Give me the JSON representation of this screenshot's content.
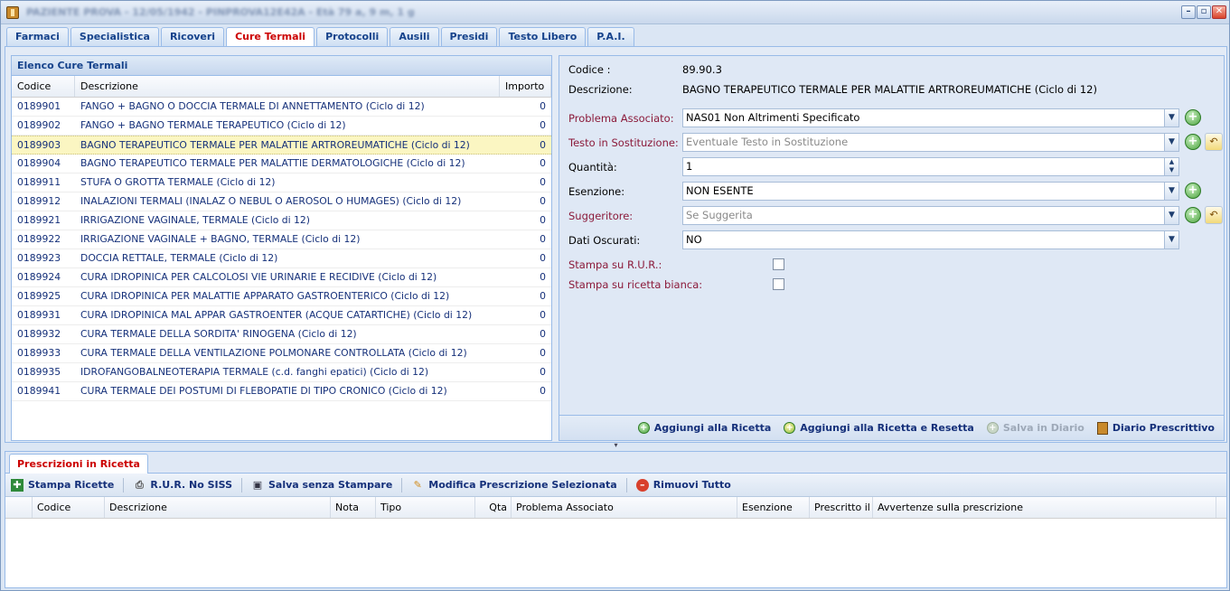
{
  "window": {
    "title": "PAZIENTE PROVA - 12/05/1942 - PINPROVA12E42A - Età 79 a, 9 m, 1 g"
  },
  "tabs": [
    "Farmaci",
    "Specialistica",
    "Ricoveri",
    "Cure Termali",
    "Protocolli",
    "Ausili",
    "Presidi",
    "Testo Libero",
    "P.A.I."
  ],
  "active_tab": "Cure Termali",
  "list": {
    "title": "Elenco Cure Termali",
    "columns": {
      "codice": "Codice",
      "descrizione": "Descrizione",
      "importo": "Importo"
    },
    "rows": [
      {
        "codice": "0189901",
        "descrizione": "FANGO + BAGNO O DOCCIA TERMALE DI ANNETTAMENTO (Ciclo di 12)",
        "importo": "0"
      },
      {
        "codice": "0189902",
        "descrizione": "FANGO + BAGNO TERMALE TERAPEUTICO (Ciclo di 12)",
        "importo": "0"
      },
      {
        "codice": "0189903",
        "descrizione": "BAGNO TERAPEUTICO TERMALE PER MALATTIE ARTROREUMATICHE (Ciclo di 12)",
        "importo": "0"
      },
      {
        "codice": "0189904",
        "descrizione": "BAGNO TERAPEUTICO TERMALE PER MALATTIE DERMATOLOGICHE (Ciclo di 12)",
        "importo": "0"
      },
      {
        "codice": "0189911",
        "descrizione": "STUFA O GROTTA TERMALE (Ciclo di 12)",
        "importo": "0"
      },
      {
        "codice": "0189912",
        "descrizione": "INALAZIONI TERMALI (INALAZ O NEBUL O AEROSOL O HUMAGES) (Ciclo di 12)",
        "importo": "0"
      },
      {
        "codice": "0189921",
        "descrizione": "IRRIGAZIONE VAGINALE, TERMALE (Ciclo di 12)",
        "importo": "0"
      },
      {
        "codice": "0189922",
        "descrizione": "IRRIGAZIONE VAGINALE + BAGNO, TERMALE (Ciclo di 12)",
        "importo": "0"
      },
      {
        "codice": "0189923",
        "descrizione": "DOCCIA RETTALE, TERMALE (Ciclo di 12)",
        "importo": "0"
      },
      {
        "codice": "0189924",
        "descrizione": "CURA IDROPINICA PER CALCOLOSI VIE URINARIE E RECIDIVE (Ciclo di 12)",
        "importo": "0"
      },
      {
        "codice": "0189925",
        "descrizione": "CURA IDROPINICA PER MALATTIE APPARATO GASTROENTERICO (Ciclo di 12)",
        "importo": "0"
      },
      {
        "codice": "0189931",
        "descrizione": "CURA IDROPINICA MAL APPAR GASTROENTER (ACQUE CATARTICHE) (Ciclo di 12)",
        "importo": "0"
      },
      {
        "codice": "0189932",
        "descrizione": "CURA TERMALE DELLA SORDITA' RINOGENA (Ciclo di 12)",
        "importo": "0"
      },
      {
        "codice": "0189933",
        "descrizione": "CURA TERMALE DELLA VENTILAZIONE POLMONARE CONTROLLATA (Ciclo di 12)",
        "importo": "0"
      },
      {
        "codice": "0189935",
        "descrizione": "IDROFANGOBALNEOTERAPIA TERMALE (c.d. fanghi epatici) (Ciclo di 12)",
        "importo": "0"
      },
      {
        "codice": "0189941",
        "descrizione": "CURA TERMALE DEI POSTUMI DI FLEBOPATIE DI TIPO CRONICO (Ciclo di 12)",
        "importo": "0"
      }
    ],
    "selected_index": 2
  },
  "detail": {
    "codice_label": "Codice :",
    "codice_value": "89.90.3",
    "descrizione_label": "Descrizione:",
    "descrizione_value": "BAGNO TERAPEUTICO TERMALE PER MALATTIE ARTROREUMATICHE (Ciclo di 12)",
    "problema_label": "Problema Associato:",
    "problema_value": "NAS01 Non Altrimenti Specificato",
    "testo_label": "Testo in Sostituzione:",
    "testo_placeholder": "Eventuale Testo in Sostituzione",
    "quantita_label": "Quantità:",
    "quantita_value": "1",
    "esenzione_label": "Esenzione:",
    "esenzione_value": "NON ESENTE",
    "suggeritore_label": "Suggeritore:",
    "suggeritore_placeholder": "Se Suggerita",
    "oscurati_label": "Dati Oscurati:",
    "oscurati_value": "NO",
    "rur_label": "Stampa su R.U.R.:",
    "bianca_label": "Stampa su ricetta bianca:"
  },
  "detail_buttons": {
    "aggiungi": "Aggiungi alla Ricetta",
    "aggiungi_reset": "Aggiungi alla Ricetta e Resetta",
    "salva_diario": "Salva in Diario",
    "diario": "Diario Prescrittivo"
  },
  "bottom": {
    "tab": "Prescrizioni in Ricetta",
    "toolbar": {
      "stampa": "Stampa Ricette",
      "rur": "R.U.R. No SISS",
      "salva": "Salva senza Stampare",
      "modifica": "Modifica Prescrizione Selezionata",
      "rimuovi": "Rimuovi Tutto"
    },
    "columns": {
      "codice": "Codice",
      "descrizione": "Descrizione",
      "nota": "Nota",
      "tipo": "Tipo",
      "qta": "Qta",
      "problema": "Problema Associato",
      "esenzione": "Esenzione",
      "prescritto": "Prescritto il",
      "avvertenze": "Avvertenze sulla prescrizione"
    }
  }
}
